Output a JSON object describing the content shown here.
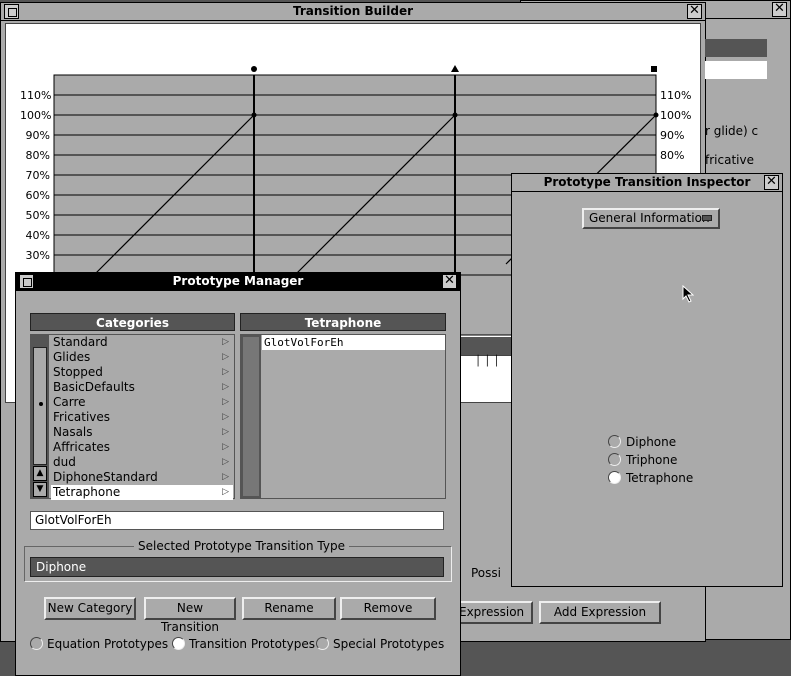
{
  "transition_builder": {
    "title": "Transition Builder",
    "yticks": [
      "110%",
      "100%",
      "90%",
      "80%",
      "70%",
      "60%",
      "50%",
      "40%",
      "30%",
      "20%"
    ],
    "partial_text": [
      "r glide) c",
      "fricative",
      "70%"
    ],
    "lower_partial": "Possi",
    "buttons": {
      "expression_partial": "Expression",
      "add_expression": "Add Expression"
    }
  },
  "prototype_manager": {
    "title": "Prototype Manager",
    "categories_header": "Categories",
    "categories": [
      "Standard",
      "Glides",
      "Stopped",
      "BasicDefaults",
      "Carre",
      "Fricatives",
      "Nasals",
      "Affricates",
      "dud",
      "DiphoneStandard",
      "Tetraphone"
    ],
    "selected_category": "Tetraphone",
    "right_header": "Tetraphone",
    "prototypes": [
      "GlotVolForEh"
    ],
    "name_field": "GlotVolForEh",
    "type_group_label": "Selected Prototype Transition Type",
    "type_value": "Diphone",
    "buttons": {
      "new_category": "New Category",
      "new_transition": "New Transition",
      "rename": "Rename",
      "remove": "Remove"
    },
    "modes": [
      {
        "label": "Equation Prototypes",
        "selected": false
      },
      {
        "label": "Transition Prototypes",
        "selected": true
      },
      {
        "label": "Special Prototypes",
        "selected": false
      }
    ]
  },
  "inspector": {
    "title": "Prototype Transition Inspector",
    "popup": "General Information",
    "options": [
      {
        "label": "Diphone",
        "selected": false
      },
      {
        "label": "Triphone",
        "selected": false
      },
      {
        "label": "Tetraphone",
        "selected": true
      }
    ]
  }
}
